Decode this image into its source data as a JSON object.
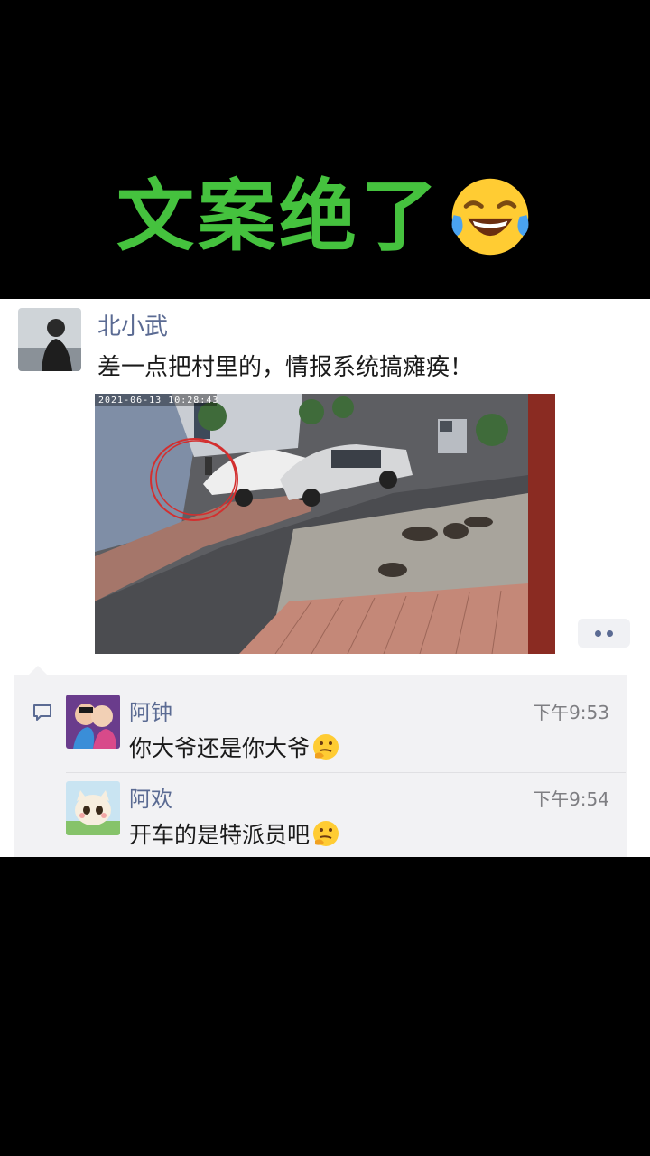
{
  "headline": {
    "text": "文案绝了"
  },
  "post": {
    "author": "北小武",
    "text": "差一点把村里的，情报系统搞瘫痪！",
    "camera_timestamp": "2021-06-13  10:28:43"
  },
  "comments": [
    {
      "name": "阿钟",
      "time": "下午9:53",
      "text": "你大爷还是你大爷"
    },
    {
      "name": "阿欢",
      "time": "下午9:54",
      "text": "开车的是特派员吧"
    }
  ],
  "colors": {
    "headline_green": "#45c23e",
    "name_blue": "#5b6b93",
    "comment_bg": "#f2f2f4"
  },
  "icons": [
    "laughing-tears-emoji",
    "thinking-emoji",
    "comment-icon",
    "more-dots-icon"
  ]
}
